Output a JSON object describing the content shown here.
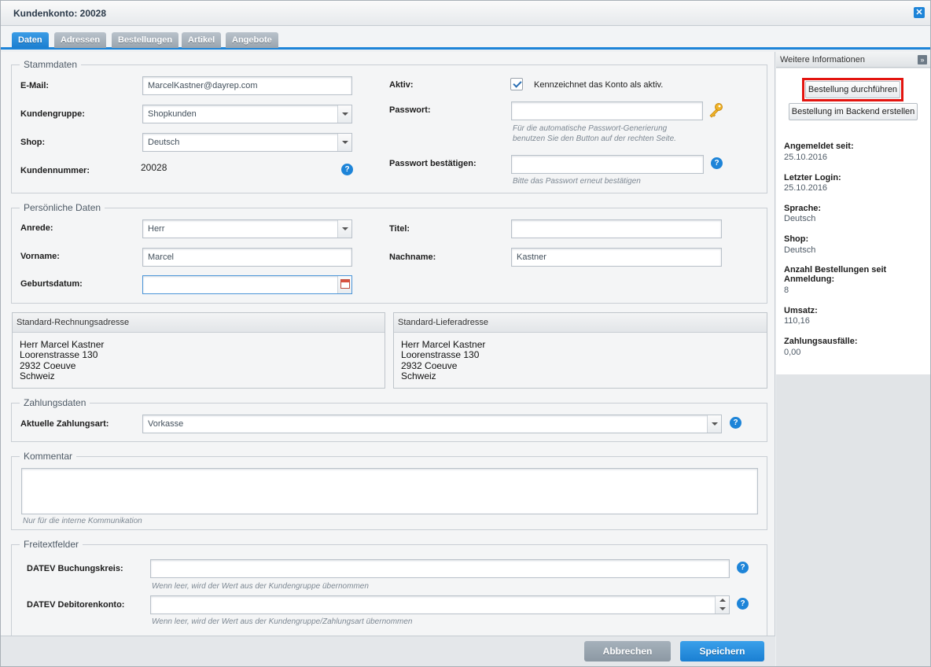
{
  "window": {
    "title": "Kundenkonto: 20028",
    "close_glyph": "✕"
  },
  "tabs": [
    "Daten",
    "Adressen",
    "Bestellungen",
    "Artikel",
    "Angebote"
  ],
  "stammdaten": {
    "legend": "Stammdaten",
    "email_label": "E-Mail:",
    "email_value": "MarcelKastner@dayrep.com",
    "kundengruppe_label": "Kundengruppe:",
    "kundengruppe_value": "Shopkunden",
    "shop_label": "Shop:",
    "shop_value": "Deutsch",
    "kundennummer_label": "Kundennummer:",
    "kundennummer_value": "20028",
    "aktiv_label": "Aktiv:",
    "aktiv_checked": true,
    "aktiv_text": "Kennzeichnet das Konto als aktiv.",
    "passwort_label": "Passwort:",
    "passwort_value": "",
    "passwort_hint": "Für die automatische Passwort-Generierung benutzen Sie den Button auf der rechten Seite.",
    "passwort_confirm_label": "Passwort bestätigen:",
    "passwort_confirm_value": "",
    "passwort_confirm_hint": "Bitte das Passwort erneut bestätigen"
  },
  "persoenlich": {
    "legend": "Persönliche Daten",
    "anrede_label": "Anrede:",
    "anrede_value": "Herr",
    "vorname_label": "Vorname:",
    "vorname_value": "Marcel",
    "geburtsdatum_label": "Geburtsdatum:",
    "geburtsdatum_value": "",
    "titel_label": "Titel:",
    "titel_value": "",
    "nachname_label": "Nachname:",
    "nachname_value": "Kastner"
  },
  "rechnung": {
    "title": "Standard-Rechnungsadresse",
    "lines": [
      "Herr Marcel Kastner",
      "Loorenstrasse 130",
      "2932 Coeuve",
      "Schweiz"
    ]
  },
  "liefer": {
    "title": "Standard-Lieferadresse",
    "lines": [
      "Herr Marcel Kastner",
      "Loorenstrasse 130",
      "2932 Coeuve",
      "Schweiz"
    ]
  },
  "zahlung": {
    "legend": "Zahlungsdaten",
    "art_label": "Aktuelle Zahlungsart:",
    "art_value": "Vorkasse"
  },
  "kommentar": {
    "legend": "Kommentar",
    "value": "",
    "hint": "Nur für die interne Kommunikation"
  },
  "freitext": {
    "legend": "Freitextfelder",
    "buchungskreis_label": "DATEV Buchungskreis:",
    "buchungskreis_value": "",
    "buchungskreis_hint": "Wenn leer, wird der Wert aus der Kundengruppe übernommen",
    "debitor_label": "DATEV Debitorenkonto:",
    "debitor_value": "",
    "debitor_hint": "Wenn leer, wird der Wert aus der Kundengruppe/Zahlungsart übernommen"
  },
  "sidebar": {
    "title": "Weitere Informationen",
    "collapse_glyph": "»",
    "btn_order": "Bestellung durchführen",
    "btn_backend": "Bestellung im Backend erstellen",
    "info": [
      {
        "key": "Angemeldet seit:",
        "value": "25.10.2016"
      },
      {
        "key": "Letzter Login:",
        "value": "25.10.2016"
      },
      {
        "key": "Sprache:",
        "value": "Deutsch"
      },
      {
        "key": "Shop:",
        "value": "Deutsch"
      },
      {
        "key": "Anzahl Bestellungen seit Anmeldung:",
        "value": "8"
      },
      {
        "key": "Umsatz:",
        "value": "110,16"
      },
      {
        "key": "Zahlungsausfälle:",
        "value": "0,00"
      }
    ]
  },
  "footer": {
    "cancel": "Abbrechen",
    "save": "Speichern"
  },
  "colors": {
    "accent": "#1d84d8",
    "highlight": "#e3140f"
  },
  "help_glyph": "?"
}
